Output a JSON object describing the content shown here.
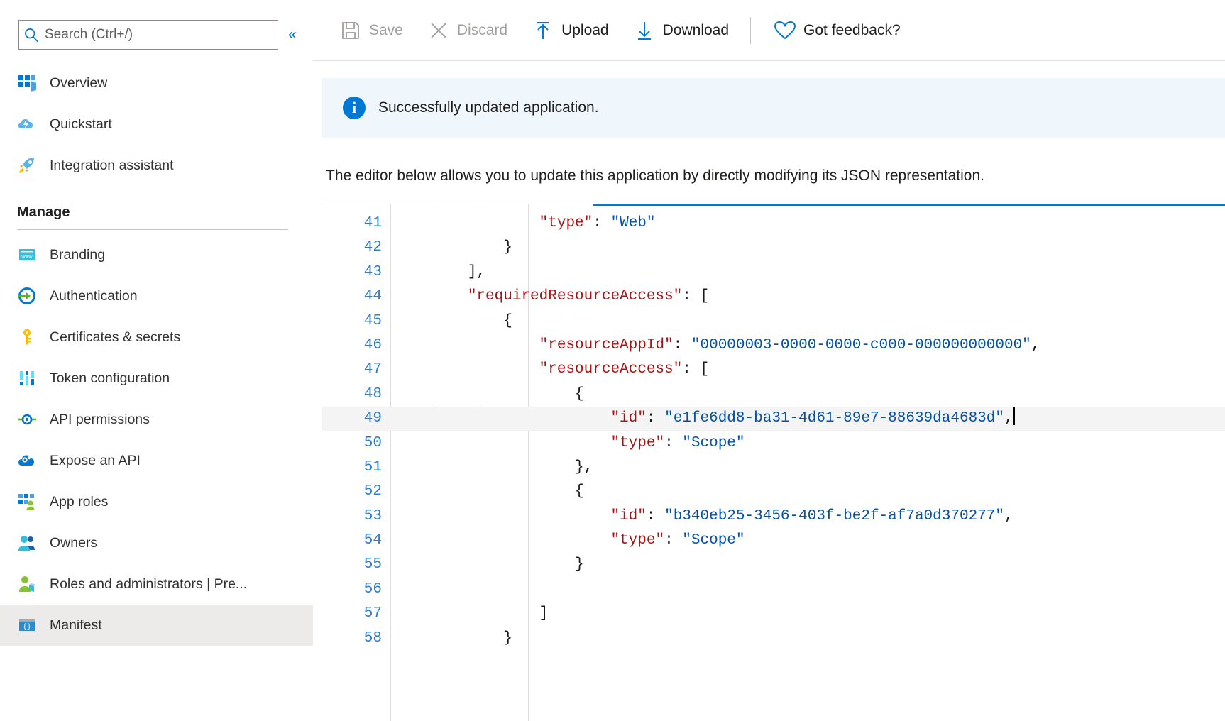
{
  "sidebar": {
    "search": {
      "placeholder": "Search (Ctrl+/)",
      "value": "",
      "icon": "search-icon"
    },
    "collapse_label": "«",
    "items": [
      {
        "label": "Overview",
        "icon": "overview-grid-icon",
        "selected": false
      },
      {
        "label": "Quickstart",
        "icon": "quickstart-cloud-icon",
        "selected": false
      },
      {
        "label": "Integration assistant",
        "icon": "rocket-icon",
        "selected": false
      }
    ],
    "group": {
      "title": "Manage"
    },
    "manage_items": [
      {
        "label": "Branding",
        "icon": "branding-www-icon",
        "selected": false
      },
      {
        "label": "Authentication",
        "icon": "authentication-arrow-icon",
        "selected": false
      },
      {
        "label": "Certificates & secrets",
        "icon": "key-icon",
        "selected": false
      },
      {
        "label": "Token configuration",
        "icon": "token-bars-icon",
        "selected": false
      },
      {
        "label": "API permissions",
        "icon": "api-permissions-icon",
        "selected": false
      },
      {
        "label": "Expose an API",
        "icon": "expose-api-cloud-gear-icon",
        "selected": false
      },
      {
        "label": "App roles",
        "icon": "app-roles-icon",
        "selected": false
      },
      {
        "label": "Owners",
        "icon": "owners-people-icon",
        "selected": false
      },
      {
        "label": "Roles and administrators | Pre...",
        "icon": "roles-admin-icon",
        "selected": false
      },
      {
        "label": "Manifest",
        "icon": "manifest-braces-icon",
        "selected": true
      }
    ]
  },
  "toolbar": {
    "buttons": [
      {
        "label": "Save",
        "icon": "save-disk-icon",
        "disabled": true
      },
      {
        "label": "Discard",
        "icon": "discard-x-icon",
        "disabled": true
      },
      {
        "label": "Upload",
        "icon": "upload-arrow-up-icon",
        "disabled": false
      },
      {
        "label": "Download",
        "icon": "download-arrow-down-icon",
        "disabled": false
      }
    ],
    "feedback": {
      "label": "Got feedback?",
      "icon": "heart-icon"
    }
  },
  "notification": {
    "icon": "info-circle-icon",
    "text": "Successfully updated application."
  },
  "description": "The editor below allows you to update this application by directly modifying its JSON representation.",
  "editor": {
    "first_visible_line": 41,
    "current_line": 49,
    "cursor_line": 49,
    "lines": [
      {
        "num": "41",
        "indent": 4,
        "tokens": [
          {
            "t": "\"type\"",
            "c": "key"
          },
          {
            "t": ": ",
            "c": "pun"
          },
          {
            "t": "\"Web\"",
            "c": "str"
          }
        ]
      },
      {
        "num": "42",
        "indent": 3,
        "tokens": [
          {
            "t": "}",
            "c": "pun"
          }
        ]
      },
      {
        "num": "43",
        "indent": 2,
        "tokens": [
          {
            "t": "],",
            "c": "pun"
          }
        ]
      },
      {
        "num": "44",
        "indent": 2,
        "tokens": [
          {
            "t": "\"requiredResourceAccess\"",
            "c": "key"
          },
          {
            "t": ": [",
            "c": "pun"
          }
        ]
      },
      {
        "num": "45",
        "indent": 3,
        "tokens": [
          {
            "t": "{",
            "c": "pun"
          }
        ]
      },
      {
        "num": "46",
        "indent": 4,
        "tokens": [
          {
            "t": "\"resourceAppId\"",
            "c": "key"
          },
          {
            "t": ": ",
            "c": "pun"
          },
          {
            "t": "\"00000003-0000-0000-c000-000000000000\"",
            "c": "str"
          },
          {
            "t": ",",
            "c": "pun"
          }
        ]
      },
      {
        "num": "47",
        "indent": 4,
        "tokens": [
          {
            "t": "\"resourceAccess\"",
            "c": "key"
          },
          {
            "t": ": [",
            "c": "pun"
          }
        ]
      },
      {
        "num": "48",
        "indent": 5,
        "tokens": [
          {
            "t": "{",
            "c": "pun"
          }
        ]
      },
      {
        "num": "49",
        "indent": 6,
        "tokens": [
          {
            "t": "\"id\"",
            "c": "key"
          },
          {
            "t": ": ",
            "c": "pun"
          },
          {
            "t": "\"e1fe6dd8-ba31-4d61-89e7-88639da4683d\"",
            "c": "str"
          },
          {
            "t": ",",
            "c": "pun"
          }
        ]
      },
      {
        "num": "50",
        "indent": 6,
        "tokens": [
          {
            "t": "\"type\"",
            "c": "key"
          },
          {
            "t": ": ",
            "c": "pun"
          },
          {
            "t": "\"Scope\"",
            "c": "str"
          }
        ]
      },
      {
        "num": "51",
        "indent": 5,
        "tokens": [
          {
            "t": "},",
            "c": "pun"
          }
        ]
      },
      {
        "num": "52",
        "indent": 5,
        "tokens": [
          {
            "t": "{",
            "c": "pun"
          }
        ]
      },
      {
        "num": "53",
        "indent": 6,
        "tokens": [
          {
            "t": "\"id\"",
            "c": "key"
          },
          {
            "t": ": ",
            "c": "pun"
          },
          {
            "t": "\"b340eb25-3456-403f-be2f-af7a0d370277\"",
            "c": "str"
          },
          {
            "t": ",",
            "c": "pun"
          }
        ]
      },
      {
        "num": "54",
        "indent": 6,
        "tokens": [
          {
            "t": "\"type\"",
            "c": "key"
          },
          {
            "t": ": ",
            "c": "pun"
          },
          {
            "t": "\"Scope\"",
            "c": "str"
          }
        ]
      },
      {
        "num": "55",
        "indent": 5,
        "tokens": [
          {
            "t": "}",
            "c": "pun"
          }
        ]
      },
      {
        "num": "56",
        "indent": 0,
        "tokens": []
      },
      {
        "num": "57",
        "indent": 4,
        "tokens": [
          {
            "t": "]",
            "c": "pun"
          }
        ]
      },
      {
        "num": "58",
        "indent": 3,
        "tokens": [
          {
            "t": "}",
            "c": "pun"
          }
        ]
      }
    ]
  },
  "colors": {
    "accent": "#0078d4",
    "notification_bg": "#eff6fc",
    "selected_nav_bg": "#edebe9",
    "code_key": "#a31515",
    "code_string": "#0451a5",
    "line_number": "#2b7cd3",
    "current_line_bg": "#f4f4f4"
  }
}
